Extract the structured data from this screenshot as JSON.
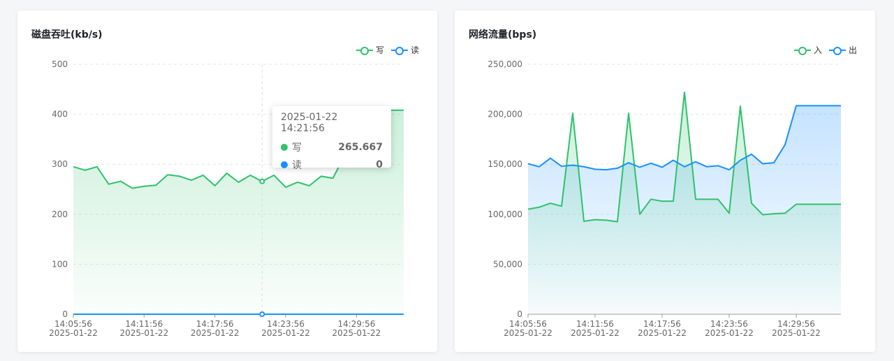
{
  "disk": {
    "title": "磁盘吞吐(kb/s)",
    "legend": [
      {
        "name": "写",
        "color": "#2ec26a"
      },
      {
        "name": "读",
        "color": "#1890ff"
      }
    ],
    "tooltip": {
      "time": "2025-01-22 14:21:56",
      "rows": [
        {
          "name": "写",
          "value": "265.667",
          "color": "#2ec26a"
        },
        {
          "name": "读",
          "value": "0",
          "color": "#1890ff"
        }
      ]
    }
  },
  "net": {
    "title": "网络流量(bps)",
    "legend": [
      {
        "name": "入",
        "color": "#2ec26a"
      },
      {
        "name": "出",
        "color": "#1890ff"
      }
    ]
  },
  "chart_data": [
    {
      "type": "area",
      "title": "磁盘吞吐(kb/s)",
      "ylim": [
        0,
        500
      ],
      "yticks": [
        0,
        100,
        200,
        300,
        400,
        500
      ],
      "ytick_labels": [
        "0",
        "100",
        "200",
        "300",
        "400",
        "500"
      ],
      "xtick_times": [
        "14:05:56",
        "14:11:56",
        "14:17:56",
        "14:23:56",
        "14:29:56"
      ],
      "xtick_date": "2025-01-22",
      "xtick_indices": [
        0,
        6,
        12,
        18,
        24
      ],
      "grid": true,
      "legend_position": "top-right",
      "highlight_index": 16,
      "series": [
        {
          "name": "写",
          "color": "#2ec26a",
          "values": [
            295,
            288,
            295,
            260,
            266,
            252,
            256,
            258,
            279,
            276,
            268,
            278,
            257,
            282,
            264,
            278,
            265.667,
            278,
            254,
            264,
            257,
            276,
            272,
            318,
            360,
            402,
            408,
            408,
            408
          ]
        },
        {
          "name": "读",
          "color": "#1890ff",
          "values": [
            0,
            0,
            0,
            0,
            0,
            0,
            0,
            0,
            0,
            0,
            0,
            0,
            0,
            0,
            0,
            0,
            0,
            0,
            0,
            0,
            0,
            0,
            0,
            0,
            0,
            0,
            0,
            0,
            0
          ]
        }
      ]
    },
    {
      "type": "area",
      "title": "网络流量(bps)",
      "ylim": [
        0,
        250000
      ],
      "yticks": [
        0,
        50000,
        100000,
        150000,
        200000,
        250000
      ],
      "ytick_labels": [
        "0",
        "50,000",
        "100,000",
        "150,000",
        "200,000",
        "250,000"
      ],
      "xtick_times": [
        "14:05:56",
        "14:11:56",
        "14:17:56",
        "14:23:56",
        "14:29:56"
      ],
      "xtick_date": "2025-01-22",
      "xtick_indices": [
        0,
        6,
        12,
        18,
        24
      ],
      "grid": true,
      "legend_position": "top-right",
      "series": [
        {
          "name": "入",
          "color": "#2ec26a",
          "values": [
            105000,
            107000,
            111000,
            108000,
            201000,
            93000,
            94500,
            94000,
            92500,
            201000,
            100000,
            115000,
            113000,
            113000,
            222000,
            115000,
            115000,
            115000,
            101000,
            208000,
            111000,
            99500,
            100500,
            101000,
            110000,
            110000,
            110000,
            110000,
            110000
          ]
        },
        {
          "name": "出",
          "color": "#1890ff",
          "values": [
            150500,
            147500,
            156000,
            148000,
            149000,
            147500,
            145000,
            144500,
            146000,
            151500,
            147000,
            151000,
            147000,
            154000,
            147500,
            152500,
            147500,
            148500,
            144500,
            154000,
            160000,
            150500,
            151500,
            169500,
            208500,
            208500,
            208500,
            208500,
            208500
          ]
        }
      ]
    }
  ]
}
